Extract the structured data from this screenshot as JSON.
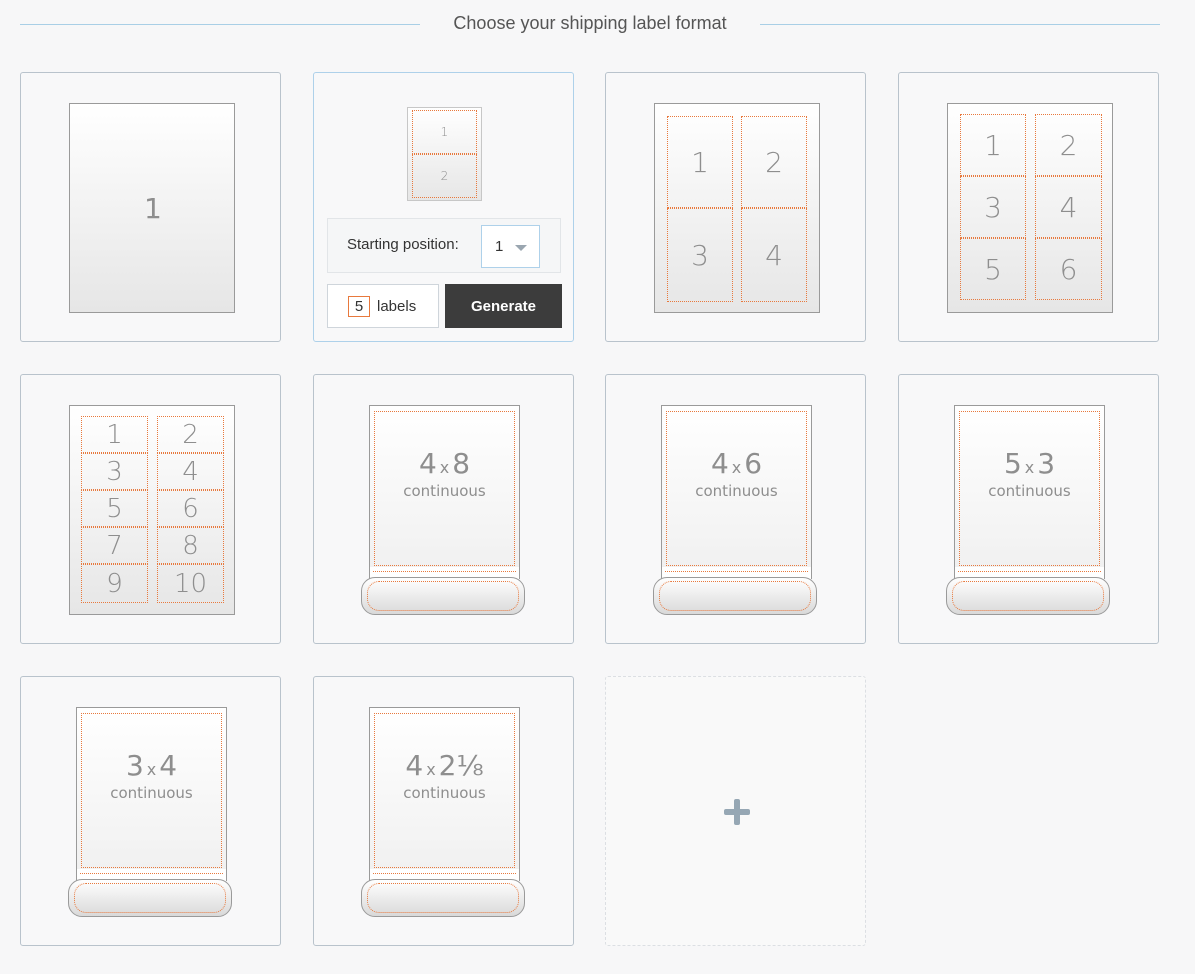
{
  "header": {
    "title": "Choose your shipping label format"
  },
  "formats": {
    "one": {
      "n1": "1"
    },
    "two": {
      "n1": "1",
      "n2": "2"
    },
    "four": {
      "n1": "1",
      "n2": "2",
      "n3": "3",
      "n4": "4"
    },
    "six": {
      "n1": "1",
      "n2": "2",
      "n3": "3",
      "n4": "4",
      "n5": "5",
      "n6": "6"
    },
    "ten": {
      "n1": "1",
      "n2": "2",
      "n3": "3",
      "n4": "4",
      "n5": "5",
      "n6": "6",
      "n7": "7",
      "n8": "8",
      "n9": "9",
      "n10": "10"
    },
    "roll_4x8": {
      "w": "4",
      "x": "x",
      "h": "8",
      "kind": "continuous"
    },
    "roll_4x6": {
      "w": "4",
      "x": "x",
      "h": "6",
      "kind": "continuous"
    },
    "roll_5x3": {
      "w": "5",
      "x": "x",
      "h": "3",
      "kind": "continuous"
    },
    "roll_3x4": {
      "w": "3",
      "x": "x",
      "h": "4",
      "kind": "continuous"
    },
    "roll_4x218": {
      "w": "4",
      "x": "x",
      "h": "2⅛",
      "kind": "continuous"
    }
  },
  "selected_panel": {
    "starting_position_label": "Starting position:",
    "starting_position_value": "1",
    "labels_count": "5",
    "labels_word": "labels",
    "generate_label": "Generate"
  },
  "add_icon": "plus-icon"
}
